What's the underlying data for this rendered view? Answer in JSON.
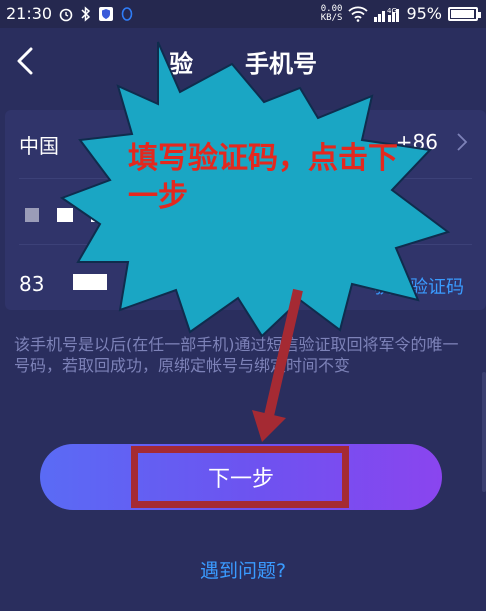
{
  "status_bar": {
    "time": "21:30",
    "net_speed_value": "0.00",
    "net_speed_unit": "KB/S",
    "battery": "95%",
    "battery_level": 0.95,
    "icons": [
      "alarm-icon",
      "bluetooth-icon",
      "shield-app-icon",
      "qq-icon",
      "wifi-icon",
      "signal-icon",
      "4g-icon",
      "battery-icon"
    ]
  },
  "header": {
    "title_visible_start": "验",
    "title_visible_end": "手机号",
    "back_icon": "chevron-left-icon"
  },
  "form": {
    "country_label": "中国",
    "country_code": "+86",
    "code_value_prefix": "83",
    "get_code_label": "获取验证码"
  },
  "hint_text": "该手机号是以后(在任一部手机)通过短信验证取回将军令的唯一号码，若取回成功，原绑定帐号与绑定时间不变",
  "next_button_label": "下一步",
  "help_link_label": "遇到问题?",
  "annotation": {
    "text": "填写验证码，点击下一步",
    "burst_color": "#1aa6c4",
    "text_color": "#e4281e",
    "arrow_color": "#a52a33"
  },
  "colors": {
    "background": "#2a2e5e",
    "card": "#30346a",
    "link": "#3a9bff",
    "button_gradient_start": "#5a6bf5",
    "button_gradient_end": "#8a45ef"
  }
}
